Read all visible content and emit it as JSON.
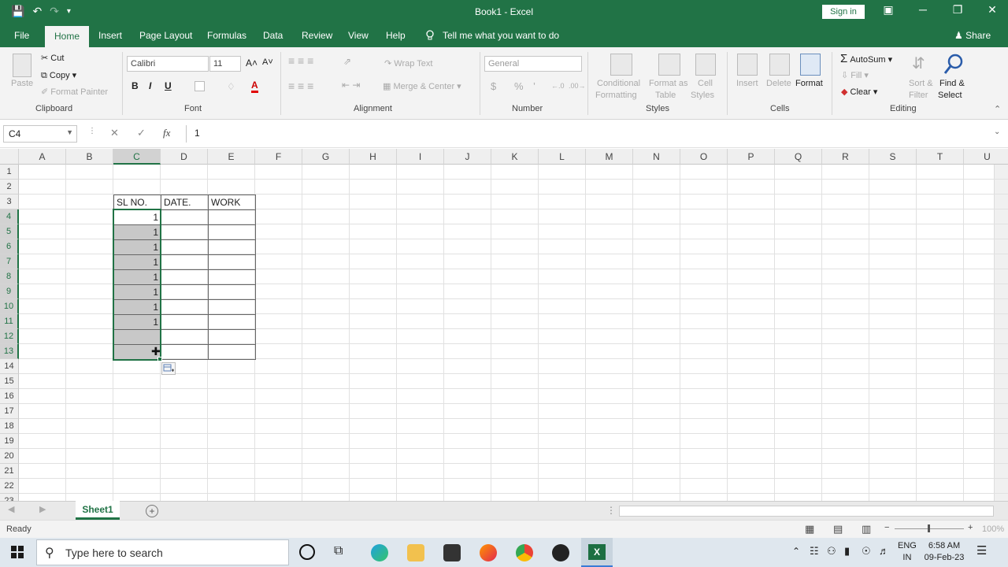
{
  "window": {
    "title": "Book1 - Excel",
    "sign_in": "Sign in",
    "qat_save": "💾",
    "qat_undo": "↶",
    "qat_redo": "↷",
    "qat_more": "▾",
    "minimize": "─",
    "maximize": "❐",
    "close": "✕",
    "ribbon_display": "▣"
  },
  "tabs": [
    "File",
    "Home",
    "Insert",
    "Page Layout",
    "Formulas",
    "Data",
    "Review",
    "View",
    "Help"
  ],
  "tell_me": "Tell me what you want to do",
  "share": "Share",
  "ribbon": {
    "clipboard": {
      "paste": "Paste",
      "cut": "Cut",
      "copy": "Copy",
      "format_painter": "Format Painter",
      "label": "Clipboard"
    },
    "font": {
      "name": "Calibri",
      "size": "11",
      "grow": "A˄",
      "shrink": "A˅",
      "bold": "B",
      "italic": "I",
      "underline": "U",
      "font_color_letter": "A",
      "label": "Font"
    },
    "alignment": {
      "wrap_text": "Wrap Text",
      "merge_center": "Merge & Center",
      "label": "Alignment"
    },
    "number": {
      "format": "General",
      "currency": "$",
      "percent": "%",
      "comma": "’",
      "inc_dec": "←.0",
      "dec_dec": ".00→",
      "label": "Number"
    },
    "styles": {
      "conditional_1": "Conditional",
      "conditional_2": "Formatting",
      "table_1": "Format as",
      "table_2": "Table",
      "cell_1": "Cell",
      "cell_2": "Styles",
      "label": "Styles"
    },
    "cells": {
      "insert": "Insert",
      "delete": "Delete",
      "format": "Format",
      "label": "Cells"
    },
    "editing": {
      "autosum": "AutoSum",
      "fill": "Fill",
      "clear": "Clear",
      "sort_1": "Sort &",
      "sort_2": "Filter",
      "find_1": "Find &",
      "find_2": "Select",
      "label": "Editing"
    }
  },
  "formula_bar": {
    "name_box": "C4",
    "cancel": "✕",
    "enter": "✓",
    "fx": "fx",
    "value": "1"
  },
  "grid": {
    "columns": [
      "A",
      "B",
      "C",
      "D",
      "E",
      "F",
      "G",
      "H",
      "I",
      "J",
      "K",
      "L",
      "M",
      "N",
      "O",
      "P",
      "Q",
      "R",
      "S",
      "T",
      "U"
    ],
    "rows": [
      "1",
      "2",
      "3",
      "4",
      "5",
      "6",
      "7",
      "8",
      "9",
      "10",
      "11",
      "12",
      "13",
      "14",
      "15",
      "16",
      "17",
      "18",
      "19",
      "20",
      "21",
      "22",
      "23"
    ],
    "header": {
      "c": "SL NO.",
      "d": "DATE.",
      "e": "WORK"
    },
    "c_values": [
      "1",
      "1",
      "1",
      "1",
      "1",
      "1",
      "1",
      "1",
      "",
      ""
    ]
  },
  "sheets": {
    "active": "Sheet1",
    "add": "+"
  },
  "status": {
    "ready": "Ready",
    "zoom": "100%",
    "zoom_minus": "−",
    "zoom_plus": "+"
  },
  "taskbar": {
    "search_placeholder": "Type here to search",
    "lang_1": "ENG",
    "lang_2": "IN",
    "time": "6:58 AM",
    "date": "09-Feb-23"
  }
}
